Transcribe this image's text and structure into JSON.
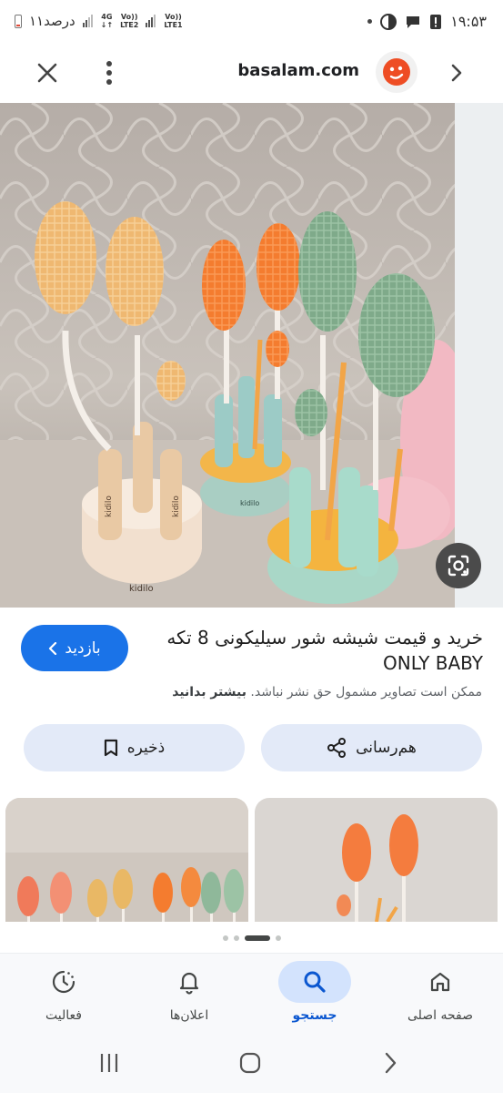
{
  "status_bar": {
    "time": "۱۹:۵۳",
    "battery_text": "۱۱درصد",
    "net_4g": "4G",
    "lte1_top": "Vo))",
    "lte1_bottom": "LTE2",
    "lte2_top": "Vo))",
    "lte2_bottom": "LTE1"
  },
  "browser": {
    "url": "basalam.com",
    "close_icon": "close-icon",
    "menu_icon": "more-vert-icon",
    "forward_icon": "chevron-right-icon",
    "site_logo": "basalam-logo"
  },
  "result": {
    "title": "خرید و قیمت شیشه شور سیلیکونی 8 تکه ONLY BABY",
    "visit_label": "بازدید",
    "notice": "ممکن است تصاویر مشمول حق نشر نباشد.",
    "learn_more": "بیشتر بدانید",
    "share_label": "هم‌رسانی",
    "save_label": "ذخیره",
    "brand_text_1": "kidilo",
    "brand_text_2": "kidilo",
    "brand_text_3": "kidilo",
    "brand_text_4": "kidilo"
  },
  "nav": {
    "items": [
      {
        "label": "صفحه اصلی",
        "icon": "home-icon"
      },
      {
        "label": "جستجو",
        "icon": "search-icon"
      },
      {
        "label": "اعلان‌ها",
        "icon": "bell-icon"
      },
      {
        "label": "فعالیت",
        "icon": "activity-icon"
      }
    ]
  },
  "colors": {
    "accent": "#1a73e8",
    "pill_bg": "#e3eaf8",
    "nav_active_bg": "#d3e3fd",
    "brush_peach": "#f2c07d",
    "brush_orange": "#f7873b",
    "brush_green": "#8fb89a"
  }
}
